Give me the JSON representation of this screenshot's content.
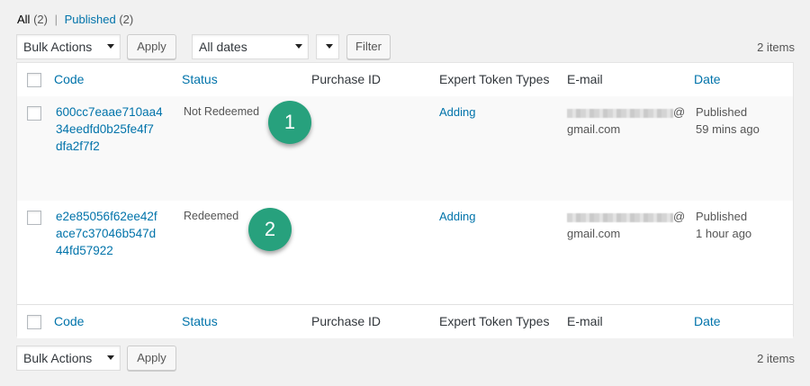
{
  "views": {
    "all_label": "All",
    "all_count": "(2)",
    "separator": "|",
    "published_label": "Published",
    "published_count": "(2)"
  },
  "top_nav": {
    "bulk_actions": "Bulk Actions",
    "apply": "Apply",
    "dates_filter": "All dates",
    "filter": "Filter",
    "items_count": "2 items"
  },
  "columns": {
    "code": "Code",
    "status": "Status",
    "purchase_id": "Purchase ID",
    "expert_token_types": "Expert Token Types",
    "email": "E-mail",
    "date": "Date"
  },
  "rows": [
    {
      "code_lines": [
        "600cc7eaae710aa4",
        "34eedfd0b25fe4f7",
        "dfa2f7f2"
      ],
      "status": "Not Redeemed",
      "purchase_id": "",
      "token_type": "Adding",
      "email_suffix": "@",
      "email_domain": "gmail.com",
      "date_status": "Published",
      "date_ago": "59 mins ago",
      "badge": "1"
    },
    {
      "code_lines": [
        "e2e85056f62ee42f",
        "ace7c37046b547d",
        "44fd57922"
      ],
      "status": "Redeemed",
      "purchase_id": "",
      "token_type": "Adding",
      "email_suffix": "@",
      "email_domain": "gmail.com",
      "date_status": "Published",
      "date_ago": "1 hour ago",
      "badge": "2"
    }
  ],
  "bottom_nav": {
    "bulk_actions": "Bulk Actions",
    "apply": "Apply",
    "items_count": "2 items"
  },
  "colors": {
    "link": "#0073aa",
    "badge": "#27a17d",
    "alt_row": "#f9f9f9"
  }
}
